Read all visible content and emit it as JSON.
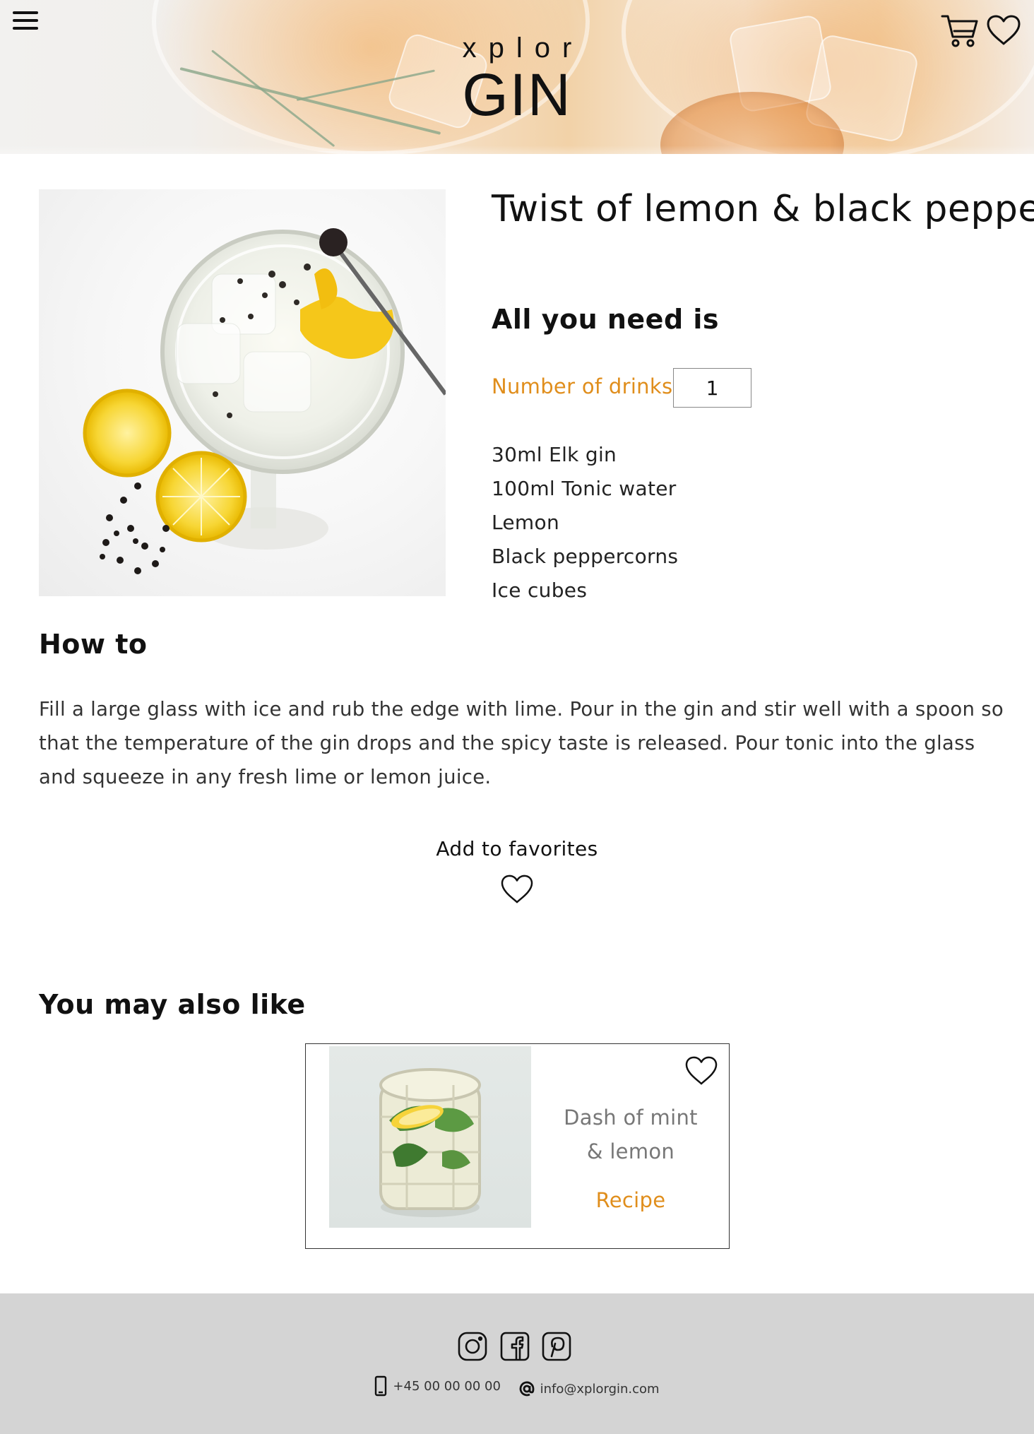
{
  "header": {
    "logo_small": "xplor",
    "logo_big": "GIN",
    "menu_icon": "hamburger-menu-icon",
    "cart_icon": "shopping-cart-icon",
    "favorites_icon": "heart-icon"
  },
  "recipe": {
    "title": "Twist of lemon & black pepper",
    "need_heading": "All you need is",
    "drinks_label": "Number of drinks",
    "drinks_value": "1",
    "ingredients": [
      "30ml Elk gin",
      "100ml Tonic water",
      "Lemon",
      "Black peppercorns",
      "Ice cubes"
    ],
    "howto_heading": "How to",
    "howto_text": "Fill a large glass with ice and rub the edge with lime. Pour in the gin and stir well with a spoon so that the temperature of the gin drops and the spicy taste is released. Pour tonic into the glass and squeeze in any fresh lime or lemon juice.",
    "add_favorites_label": "Add to favorites"
  },
  "also_like": {
    "heading": "You may also like",
    "cards": [
      {
        "name_line1": "Dash of mint",
        "name_line2": "& lemon",
        "link": "Recipe"
      }
    ]
  },
  "footer": {
    "social": [
      "instagram-icon",
      "facebook-icon",
      "pinterest-icon"
    ],
    "phone": "+45 00 00 00 00",
    "email": "info@xplorgin.com"
  },
  "colors": {
    "accent": "#e08e1c",
    "footer_bg": "#d4d4d4",
    "text": "#222222"
  }
}
